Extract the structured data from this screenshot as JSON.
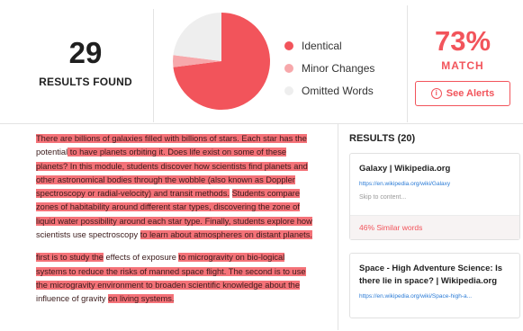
{
  "summary": {
    "count": "29",
    "count_label": "RESULTS FOUND"
  },
  "chart_data": {
    "type": "pie",
    "slices": [
      {
        "label": "Identical",
        "value": 73,
        "color": "#f2545b"
      },
      {
        "label": "Minor Changes",
        "value": 4,
        "color": "#f7a8ab"
      },
      {
        "label": "Omitted Words",
        "value": 23,
        "color": "#eeeeee"
      }
    ]
  },
  "legend": [
    {
      "label": "Identical",
      "color": "#f2545b"
    },
    {
      "label": "Minor Changes",
      "color": "#f7a8ab"
    },
    {
      "label": "Omitted Words",
      "color": "#eeeeee"
    }
  ],
  "match": {
    "percent": "73%",
    "label": "MATCH",
    "button": "See Alerts"
  },
  "document": {
    "paragraphs": [
      [
        {
          "t": "There are billions of galaxies filled with billions of stars. Each star has the ",
          "h": true
        },
        {
          "t": "potential",
          "h": false
        },
        {
          "t": " to have planets orbiting it. Does life exist on some of these planets? In this module, students discover how scientists find planets and other astronomical bodies through the wobble (also known as Doppler spectroscopy or radial-velocity) and transit methods.",
          "h": true
        },
        {
          "t": " ",
          "h": false
        },
        {
          "t": "Students compare zones of habitability around different star types, discovering the zone of liquid water possibility around each star type. Finally, students explore how",
          "h": true
        },
        {
          "t": " scientists use spectroscopy ",
          "h": false
        },
        {
          "t": "to learn about atmospheres on distant planets.",
          "h": true
        }
      ],
      [
        {
          "t": "first is to study the",
          "h": true
        },
        {
          "t": " effects of exposure ",
          "h": false
        },
        {
          "t": "to microgravity on bio-logical systems to reduce the risks of manned space flight. The second is to use the microgravity environment to broaden scientific knowledge about the",
          "h": true
        },
        {
          "t": " influence of gravity ",
          "h": false
        },
        {
          "t": "on living systems.",
          "h": true
        }
      ]
    ]
  },
  "results_panel": {
    "title": "RESULTS (20)",
    "cards": [
      {
        "title": "Galaxy | Wikipedia.org",
        "url": "https://en.wikipedia.org/wiki/Galaxy",
        "snippet": "Skip to content...",
        "similar": "46% Similar words"
      },
      {
        "title": "Space - High Adventure Science: Is there lie in space? | Wikipedia.org",
        "url": "https://en.wikipedia.org/wiki/Space-high-a..."
      }
    ]
  }
}
